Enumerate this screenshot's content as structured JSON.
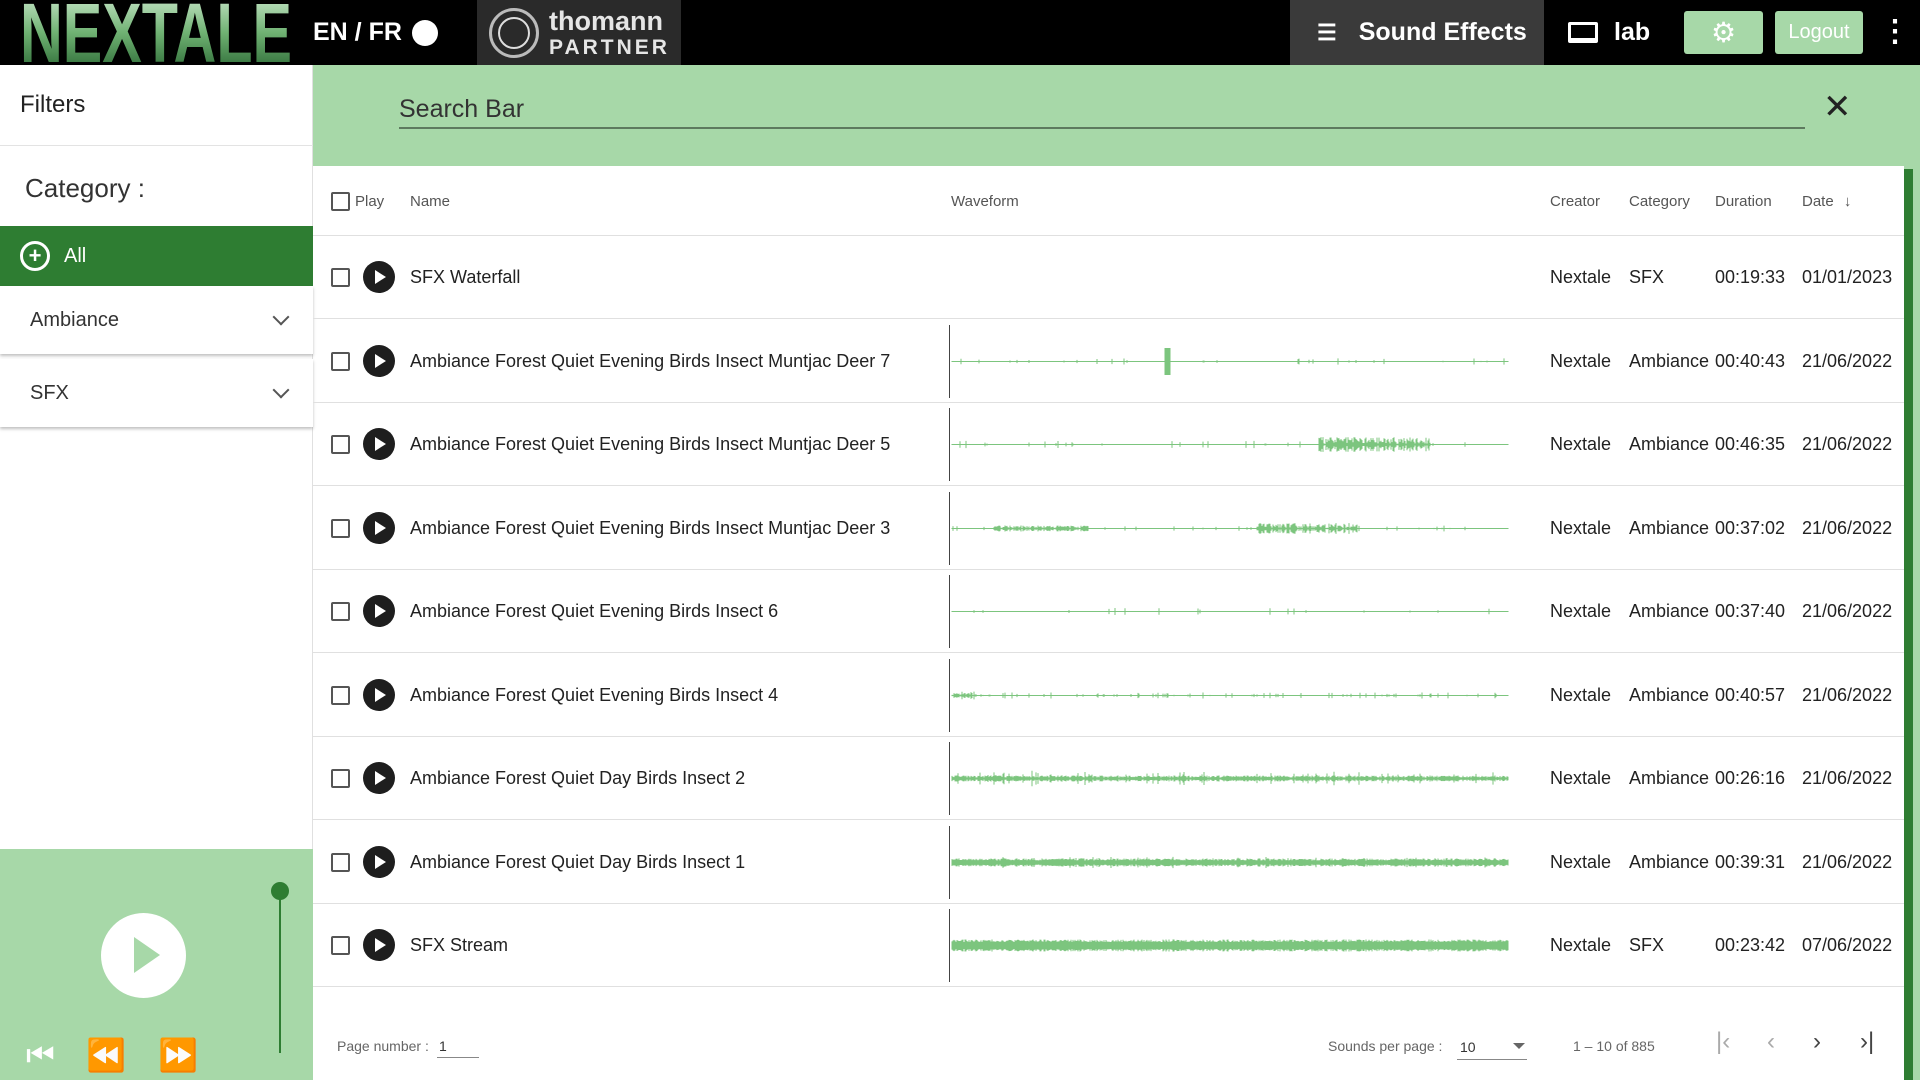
{
  "header": {
    "brand": "NEXTALE",
    "language_toggle": "EN / FR",
    "partner_line1": "thomann",
    "partner_line2": "PARTNER",
    "nav_sound_effects": "Sound Effects",
    "nav_lab": "lab",
    "logout_label": "Logout",
    "icons": [
      "list-icon",
      "laptop-icon",
      "gear-icon",
      "more-vert-icon"
    ]
  },
  "sidebar": {
    "title": "Filters",
    "category_label": "Category :",
    "all_label": "All",
    "categories": [
      {
        "label": "Ambiance"
      },
      {
        "label": "SFX"
      }
    ]
  },
  "player": {
    "volume_level": 1.0,
    "icons": [
      "play-icon",
      "skip-previous-icon",
      "rewind-icon",
      "fast-forward-icon"
    ]
  },
  "search": {
    "placeholder": "Search Bar",
    "value": ""
  },
  "table": {
    "columns": {
      "play": "Play",
      "name": "Name",
      "waveform": "Waveform",
      "creator": "Creator",
      "category": "Category",
      "duration": "Duration",
      "date": "Date"
    },
    "sort": {
      "column": "date",
      "direction": "desc"
    },
    "rows": [
      {
        "name": "SFX Waterfall",
        "creator": "Nextale",
        "category": "SFX",
        "duration": "00:19:33",
        "date": "01/01/2023",
        "waveform": "none"
      },
      {
        "name": "Ambiance Forest Quiet Evening Birds Insect Muntjac Deer 7",
        "creator": "Nextale",
        "category": "Ambiance",
        "duration": "00:40:43",
        "date": "21/06/2022",
        "waveform": "sparse"
      },
      {
        "name": "Ambiance Forest Quiet Evening Birds Insect Muntjac Deer 5",
        "creator": "Nextale",
        "category": "Ambiance",
        "duration": "00:46:35",
        "date": "21/06/2022",
        "waveform": "burst-right"
      },
      {
        "name": "Ambiance Forest Quiet Evening Birds Insect Muntjac Deer 3",
        "creator": "Nextale",
        "category": "Ambiance",
        "duration": "00:37:02",
        "date": "21/06/2022",
        "waveform": "burst-mid"
      },
      {
        "name": "Ambiance Forest Quiet Evening Birds Insect 6",
        "creator": "Nextale",
        "category": "Ambiance",
        "duration": "00:37:40",
        "date": "21/06/2022",
        "waveform": "flat"
      },
      {
        "name": "Ambiance Forest Quiet Evening Birds Insect 4",
        "creator": "Nextale",
        "category": "Ambiance",
        "duration": "00:40:57",
        "date": "21/06/2022",
        "waveform": "light"
      },
      {
        "name": "Ambiance Forest Quiet Day Birds Insect 2",
        "creator": "Nextale",
        "category": "Ambiance",
        "duration": "00:26:16",
        "date": "21/06/2022",
        "waveform": "medium"
      },
      {
        "name": "Ambiance Forest Quiet Day Birds Insect 1",
        "creator": "Nextale",
        "category": "Ambiance",
        "duration": "00:39:31",
        "date": "21/06/2022",
        "waveform": "dense"
      },
      {
        "name": "SFX Stream",
        "creator": "Nextale",
        "category": "SFX",
        "duration": "00:23:42",
        "date": "07/06/2022",
        "waveform": "full"
      }
    ]
  },
  "footer": {
    "page_number_label": "Page number :",
    "page_number_value": "1",
    "per_page_label": "Sounds per page :",
    "per_page_value": "10",
    "range_text": "1 – 10 of 885"
  },
  "colors": {
    "accent_light": "#a7d8a8",
    "accent_dark": "#2e7d32",
    "topbar": "#000000",
    "waveform": "#7cc57e"
  }
}
